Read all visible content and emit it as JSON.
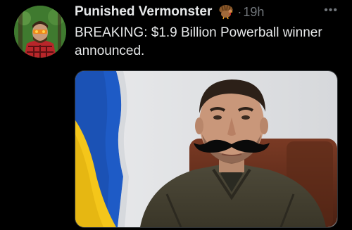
{
  "tweet": {
    "author_name": "Punished Vermonster",
    "badge_icon": "turkey-icon",
    "separator": "·",
    "time": "19h",
    "more_label": "•••",
    "text": "BREAKING: $1.9 Billion Powerball winner announced.",
    "avatar_icon": "avatar-person-icon",
    "media_icon": "photo-person-with-flag"
  },
  "colors": {
    "background": "#000000",
    "text": "#e7e9ea",
    "muted": "#71767b",
    "flag_blue": "#1e5bc6",
    "flag_yellow": "#f4c61a"
  }
}
